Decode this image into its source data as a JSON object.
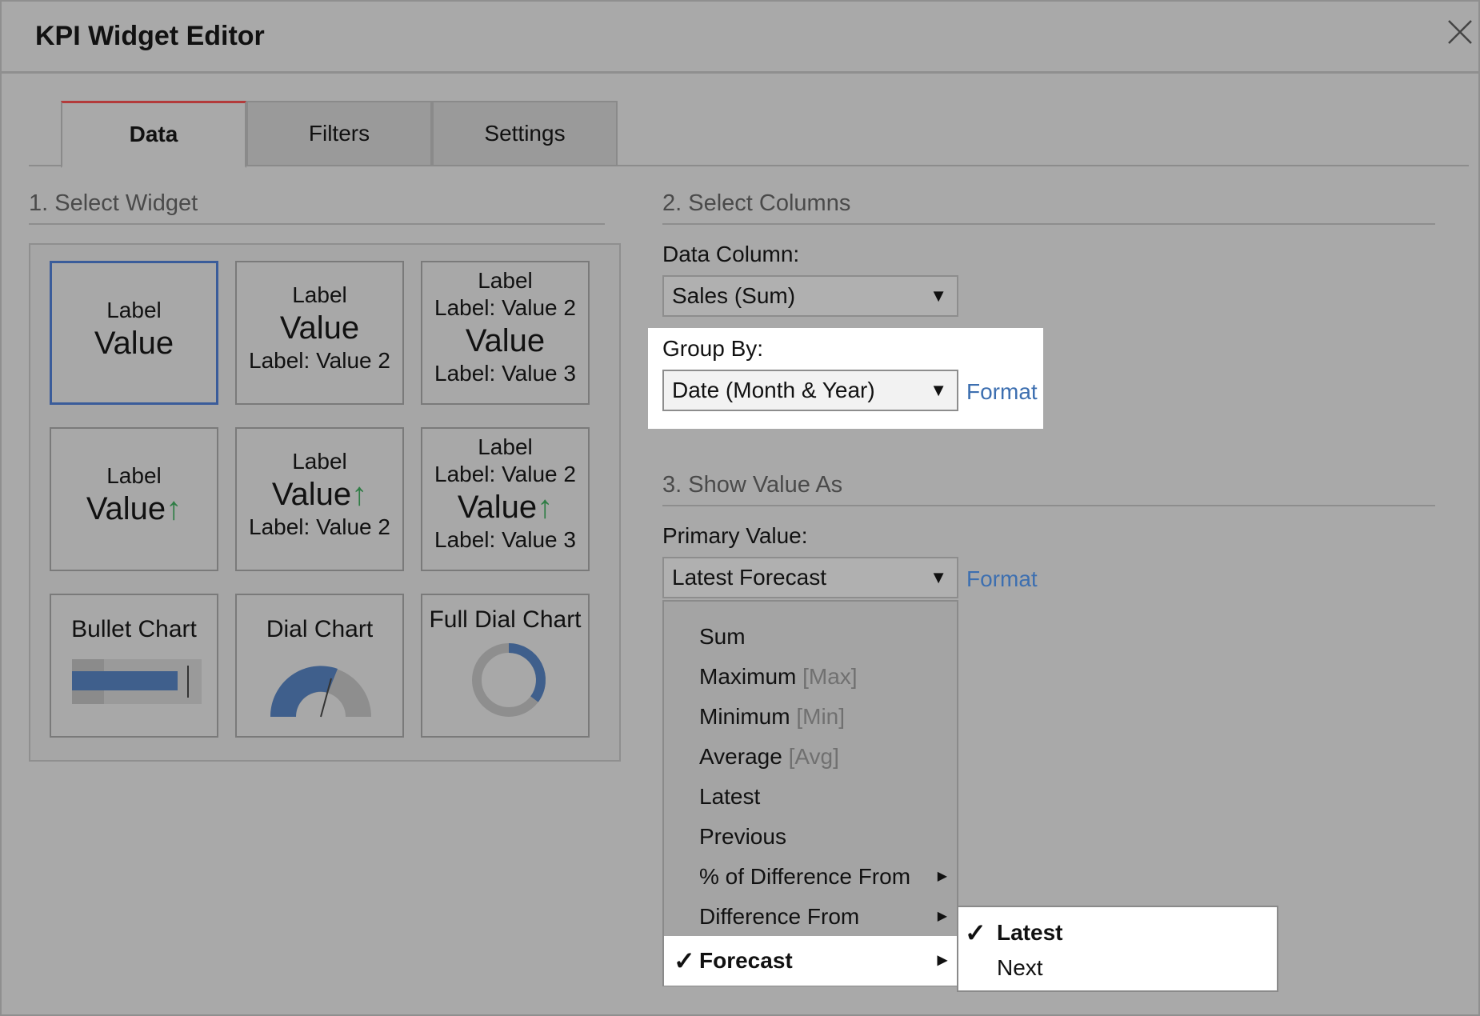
{
  "title": "KPI Widget Editor",
  "tabs": [
    {
      "label": "Data",
      "active": true
    },
    {
      "label": "Filters",
      "active": false
    },
    {
      "label": "Settings",
      "active": false
    }
  ],
  "sections": {
    "select_widget": "1. Select Widget",
    "select_columns": "2. Select Columns",
    "show_value_as": "3. Show Value As"
  },
  "widgets": {
    "w1": {
      "label": "Label",
      "value": "Value"
    },
    "w2": {
      "label": "Label",
      "value": "Value",
      "sub": "Label: Value 2"
    },
    "w3": {
      "label": "Label",
      "label2": "Label: Value 2",
      "value": "Value",
      "sub": "Label: Value 3"
    },
    "w4": {
      "label": "Label",
      "value": "Value",
      "arrow": "↑"
    },
    "w5": {
      "label": "Label",
      "value": "Value",
      "arrow": "↑",
      "sub": "Label: Value 2"
    },
    "w6": {
      "label": "Label",
      "label2": "Label: Value 2",
      "value": "Value",
      "arrow": "↑",
      "sub": "Label: Value 3"
    },
    "w7": {
      "title": "Bullet Chart"
    },
    "w8": {
      "title": "Dial Chart"
    },
    "w9": {
      "title": "Full Dial Chart"
    }
  },
  "data_column": {
    "label": "Data Column:",
    "value": "Sales (Sum)"
  },
  "group_by": {
    "label": "Group By:",
    "value": "Date (Month & Year)",
    "format_link": "Format"
  },
  "primary_value": {
    "label": "Primary Value:",
    "value": "Latest Forecast",
    "format_link": "Format"
  },
  "menu": {
    "items": [
      {
        "label": "Sum",
        "hint": ""
      },
      {
        "label": "Maximum",
        "hint": "[Max]"
      },
      {
        "label": "Minimum",
        "hint": "[Min]"
      },
      {
        "label": "Average",
        "hint": "[Avg]"
      },
      {
        "label": "Latest",
        "hint": ""
      },
      {
        "label": "Previous",
        "hint": ""
      },
      {
        "label": "% of Difference From",
        "hint": ""
      },
      {
        "label": "Difference From",
        "hint": ""
      },
      {
        "label": "Forecast",
        "hint": ""
      }
    ],
    "checked_index": 8
  },
  "submenu": {
    "items": [
      {
        "label": "Latest"
      },
      {
        "label": "Next"
      }
    ],
    "checked_index": 0
  },
  "colors": {
    "accent_tab": "#b33b3b",
    "link": "#3d6fb0",
    "selected_border": "#3a5c9a",
    "arrow": "#2f7d45",
    "chart_blue": "#3f5f8c"
  },
  "glyphs": {
    "check": "✓",
    "caret": "▼",
    "submenu_arrow": "▶"
  }
}
